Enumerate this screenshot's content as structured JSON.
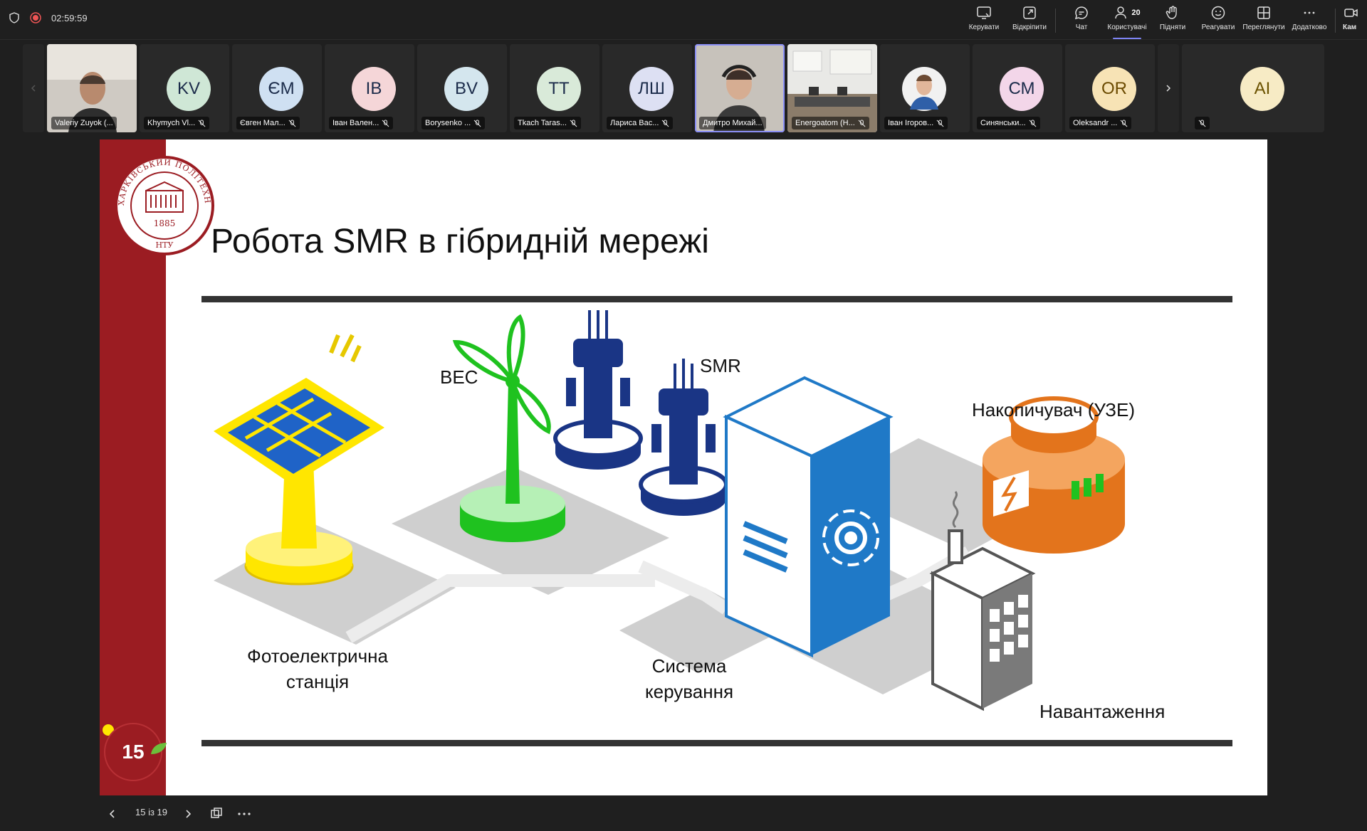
{
  "meeting": {
    "timer": "02:59:59",
    "participants_count": "20"
  },
  "toolbar": {
    "items": [
      {
        "label": "Керувати",
        "icon": "share-screen-icon"
      },
      {
        "label": "Відкріпити",
        "icon": "popout-icon"
      },
      {
        "label": "Чат",
        "icon": "chat-icon"
      },
      {
        "label": "Користувачі",
        "icon": "people-icon"
      },
      {
        "label": "Підняти",
        "icon": "raise-hand-icon"
      },
      {
        "label": "Реагувати",
        "icon": "emoji-icon"
      },
      {
        "label": "Переглянути",
        "icon": "view-grid-icon"
      },
      {
        "label": "Додатково",
        "icon": "more-icon"
      },
      {
        "label": "Кам",
        "icon": "camera-icon"
      }
    ]
  },
  "participants": [
    {
      "name": "Valeriy Zuyok (...",
      "initials": "",
      "type": "video"
    },
    {
      "name": "Khymych Vl...",
      "initials": "KV",
      "color": "#cfe7d6"
    },
    {
      "name": "Євген Мал...",
      "initials": "ЄМ",
      "color": "#cfe0f2"
    },
    {
      "name": "Іван Вален...",
      "initials": "ІВ",
      "color": "#f5d6d8"
    },
    {
      "name": "Borysenko ...",
      "initials": "BV",
      "color": "#d4e6ee"
    },
    {
      "name": "Tkach Taras...",
      "initials": "TT",
      "color": "#d9ead9"
    },
    {
      "name": "Лариса Вас...",
      "initials": "ЛШ",
      "color": "#dde0f3"
    },
    {
      "name": "Дмитро Михай...",
      "initials": "",
      "type": "video"
    },
    {
      "name": "Energoatom (Н...",
      "initials": "",
      "type": "video"
    },
    {
      "name": "Іван Ігоров...",
      "initials": "",
      "type": "photo"
    },
    {
      "name": "Синянськи...",
      "initials": "СМ",
      "color": "#f3d6e9"
    },
    {
      "name": "Oleksandr ...",
      "initials": "OR",
      "color": "#f7e3b5"
    },
    {
      "name": "",
      "initials": "AI",
      "color": "#f7ebc5"
    }
  ],
  "slide": {
    "title": "Робота SMR в гібридній мережі",
    "logo_year": "1885",
    "logo_ring": "ХАРКІВСЬКИЙ ПОЛІТЕХНІЧНИЙ ІНСТИТУТ",
    "logo_bottom": "НТУ",
    "page_number": "15",
    "labels": {
      "wind": "ВЕС",
      "smr": "SMR",
      "storage": "Накопичувач (УЗЕ)",
      "solar_line1": "Фотоелектрична",
      "solar_line2": "станція",
      "control_line1": "Система",
      "control_line2": "керування",
      "load": "Навантаження"
    }
  },
  "bottombar": {
    "page_indicator": "15 із 19"
  },
  "colors": {
    "brand_red": "#9b1c22",
    "solar_yellow": "#ffe600",
    "wind_green": "#1fc21f",
    "smr_blue": "#1a3585",
    "control_blue": "#1f79c7",
    "storage_orange": "#e3741c",
    "accent": "#7f85f5"
  }
}
